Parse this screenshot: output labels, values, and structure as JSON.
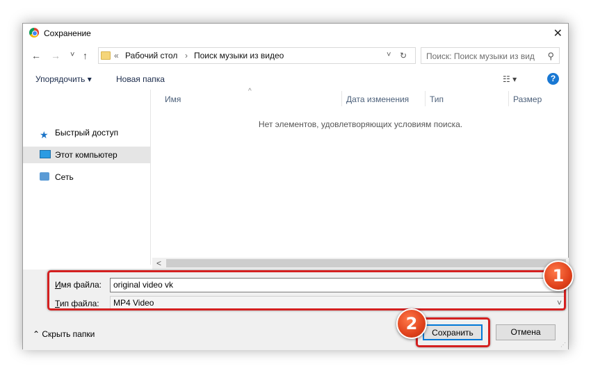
{
  "window": {
    "title": "Сохранение",
    "close_label": "✕"
  },
  "nav": {
    "back": "←",
    "forward": "→",
    "recent": "˅",
    "up": "↑",
    "breadcrumb": [
      "«",
      "Рабочий стол",
      "›",
      "Поиск музыки из видео"
    ],
    "dropdown": "˅",
    "refresh": "↻",
    "search_placeholder": "Поиск: Поиск музыки из вид",
    "search_icon": "⚲"
  },
  "toolbar": {
    "organize": "Упорядочить ▾",
    "new_folder": "Новая папка",
    "view": "☷ ▾",
    "help": "?"
  },
  "sidebar": {
    "items": [
      {
        "label": "Быстрый доступ",
        "icon": "star-icon"
      },
      {
        "label": "Этот компьютер",
        "icon": "computer-icon"
      },
      {
        "label": "Сеть",
        "icon": "network-icon"
      }
    ]
  },
  "list": {
    "columns": [
      "Имя",
      "Дата изменения",
      "Тип",
      "Размер"
    ],
    "sort_arrow": "^",
    "empty_text": "Нет элементов, удовлетворяющих условиям поиска."
  },
  "scrollbar": {
    "left_arrow": "<"
  },
  "fields": {
    "filename_label_u": "И",
    "filename_label_rest": "мя файла:",
    "filename_value": "original video vk",
    "filetype_label_u": "Т",
    "filetype_label_rest": "ип файла:",
    "filetype_value": "MP4 Video",
    "filetype_chev": "˅"
  },
  "bottom": {
    "hide_folders": "⌃ Скрыть папки",
    "save_label": "Сохранить",
    "cancel_label": "Отмена",
    "grip": "⋰"
  },
  "badges": {
    "one": "1",
    "two": "2"
  },
  "colors": {
    "annotation_red": "#d42020",
    "accent_blue": "#0078d7",
    "help_blue": "#1978d3"
  }
}
